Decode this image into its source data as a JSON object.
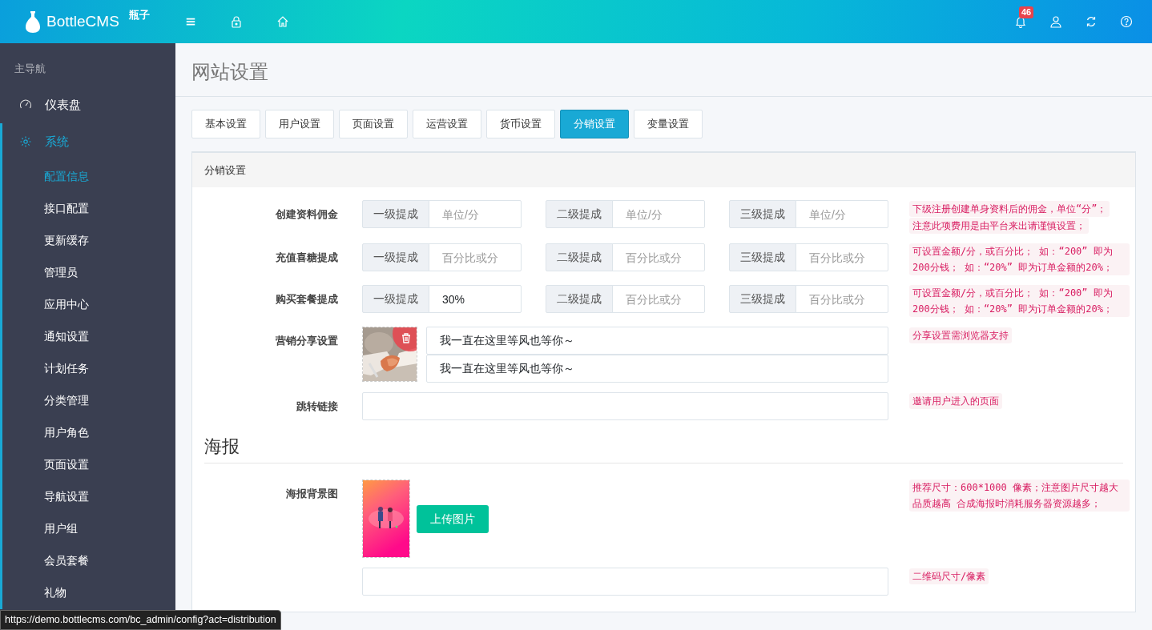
{
  "header": {
    "brand": "BottleCMS",
    "brand_sub": "瓶子",
    "notification_count": "46"
  },
  "sidebar": {
    "heading": "主导航",
    "items": [
      {
        "label": "仪表盘",
        "expanded": false
      },
      {
        "label": "系统",
        "expanded": true,
        "children": [
          {
            "label": "配置信息",
            "selected": true
          },
          {
            "label": "接口配置",
            "selected": false
          },
          {
            "label": "更新缓存",
            "selected": false
          },
          {
            "label": "管理员",
            "selected": false
          },
          {
            "label": "应用中心",
            "selected": false
          },
          {
            "label": "通知设置",
            "selected": false
          },
          {
            "label": "计划任务",
            "selected": false
          },
          {
            "label": "分类管理",
            "selected": false
          },
          {
            "label": "用户角色",
            "selected": false
          },
          {
            "label": "页面设置",
            "selected": false
          },
          {
            "label": "导航设置",
            "selected": false
          },
          {
            "label": "用户组",
            "selected": false
          },
          {
            "label": "会员套餐",
            "selected": false
          },
          {
            "label": "礼物",
            "selected": false
          }
        ]
      }
    ]
  },
  "page_title": "网站设置",
  "tabs": [
    {
      "label": "基本设置",
      "selected": false
    },
    {
      "label": "用户设置",
      "selected": false
    },
    {
      "label": "页面设置",
      "selected": false
    },
    {
      "label": "运营设置",
      "selected": false
    },
    {
      "label": "货币设置",
      "selected": false
    },
    {
      "label": "分销设置",
      "selected": true
    },
    {
      "label": "变量设置",
      "selected": false
    }
  ],
  "panel": {
    "title": "分销设置",
    "rows": [
      {
        "kind": "levels",
        "label": "创建资料佣金",
        "inputs": [
          {
            "addon": "一级提成",
            "placeholder": "单位/分"
          },
          {
            "addon": "二级提成",
            "placeholder": "单位/分"
          },
          {
            "addon": "三级提成",
            "placeholder": "单位/分"
          }
        ],
        "hint": [
          "下级注册创建单身资料后的佣金，单位“分”；",
          "注意此项费用是由平台来出请谨慎设置；"
        ]
      },
      {
        "kind": "levels",
        "label": "充值喜糖提成",
        "inputs": [
          {
            "addon": "一级提成",
            "placeholder": "百分比或分"
          },
          {
            "addon": "二级提成",
            "placeholder": "百分比或分"
          },
          {
            "addon": "三级提成",
            "placeholder": "百分比或分"
          }
        ],
        "hint": [
          "可设置金额/分，或百分比； 如：“200” 即为200分钱； 如：“20%” 即为订单金额的20%；"
        ]
      },
      {
        "kind": "levels",
        "label": "购买套餐提成",
        "inputs": [
          {
            "addon": "一级提成",
            "value": "30%"
          },
          {
            "addon": "二级提成",
            "placeholder": "百分比或分"
          },
          {
            "addon": "三级提成",
            "placeholder": "百分比或分"
          }
        ],
        "hint": [
          "可设置金额/分，或百分比； 如：“200” 即为200分钱； 如：“20%” 即为订单金额的20%；"
        ]
      },
      {
        "kind": "share",
        "label": "营销分享设置",
        "values": [
          "我一直在这里等风也等你～",
          "我一直在这里等风也等你～"
        ],
        "hint": [
          "分享设置需浏览器支持"
        ]
      },
      {
        "kind": "text",
        "label": "跳转链接",
        "hint": [
          "邀请用户进入的页面"
        ]
      }
    ],
    "poster": {
      "heading": "海报",
      "rows": [
        {
          "kind": "upload",
          "label": "海报背景图",
          "button": "上传图片",
          "hint": [
            "推荐尺寸：600*1000 像素；注意图片尺寸越大品质越高 合成海报时消耗服务器资源越多；"
          ]
        },
        {
          "kind": "text",
          "hint": [
            "二维码尺寸/像素"
          ]
        }
      ]
    }
  },
  "status_url": "https://demo.bottlecms.com/bc_admin/config?act=distribution"
}
